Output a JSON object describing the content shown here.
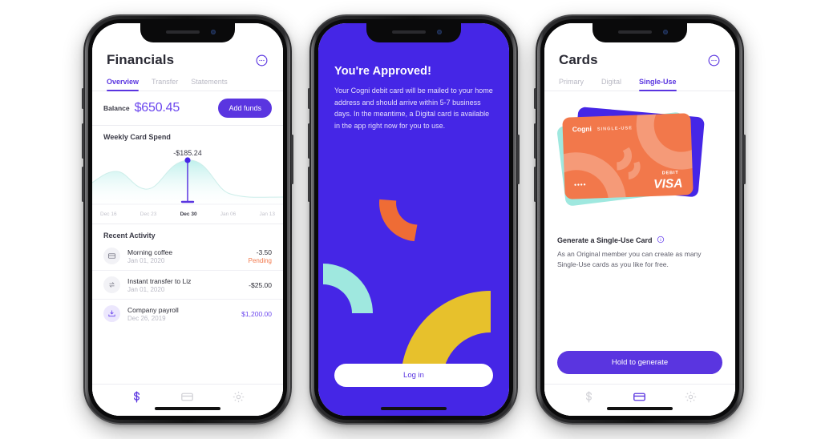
{
  "colors": {
    "brand_purple": "#5a35e0",
    "value_purple": "#6a45ee",
    "screen2_bg": "#4526e6",
    "accent_orange": "#f2784b",
    "accent_teal": "#9fe8df",
    "accent_yellow": "#e7c12c",
    "card_orange": "#f2784b",
    "muted_text": "#b9b9c4"
  },
  "phone1": {
    "header": {
      "title": "Financials",
      "support_icon": "support-chat-icon"
    },
    "tabs": [
      {
        "label": "Overview",
        "active": true
      },
      {
        "label": "Transfer",
        "active": false
      },
      {
        "label": "Statements",
        "active": false
      }
    ],
    "balance": {
      "label": "Balance",
      "value": "$650.45",
      "button": "Add funds"
    },
    "chart_section_title": "Weekly Card Spend",
    "activity": {
      "title": "Recent Activity",
      "items": [
        {
          "icon": "card-icon",
          "title": "Morning coffee",
          "date": "Jan 01, 2020",
          "amount": "-3.50",
          "status": "Pending",
          "positive": false,
          "highlight": false
        },
        {
          "icon": "transfer-arrows-icon",
          "title": "Instant transfer to Liz",
          "date": "Jan 01, 2020",
          "amount": "-$25.00",
          "status": "",
          "positive": false,
          "highlight": false
        },
        {
          "icon": "deposit-icon",
          "title": "Company payroll",
          "date": "Dec 26, 2019",
          "amount": "$1,200.00",
          "status": "",
          "positive": true,
          "highlight": true
        }
      ]
    },
    "tabbar": [
      {
        "icon": "dollar-icon",
        "active": true
      },
      {
        "icon": "card-icon",
        "active": false
      },
      {
        "icon": "gear-icon",
        "active": false
      }
    ]
  },
  "phone2": {
    "title": "You're Approved!",
    "body": "Your Cogni debit card will be mailed to your home address and should arrive within 5-7 business days. In the meantime, a Digital card is available in the app right now for you to use.",
    "login_button": "Log in"
  },
  "phone3": {
    "header": {
      "title": "Cards",
      "support_icon": "support-chat-icon"
    },
    "tabs": [
      {
        "label": "Primary",
        "active": false
      },
      {
        "label": "Digital",
        "active": false
      },
      {
        "label": "Single-Use",
        "active": true
      }
    ],
    "card": {
      "brand": "Cogni",
      "type": "SINGLE-USE",
      "dots": "••••",
      "debit_label": "DEBIT",
      "network": "VISA"
    },
    "generate": {
      "title": "Generate a Single-Use Card",
      "info_icon": "info-icon",
      "body": "As an Original member you can create as many Single-Use cards as you like for free.",
      "button": "Hold to generate"
    },
    "tabbar": [
      {
        "icon": "dollar-icon",
        "active": false
      },
      {
        "icon": "card-icon",
        "active": true
      },
      {
        "icon": "gear-icon",
        "active": false
      }
    ]
  },
  "chart_data": {
    "type": "area",
    "title": "Weekly Card Spend",
    "annotation": "-$185.24",
    "selected_category": "Dec 30",
    "categories": [
      "Dec 16",
      "Dec 23",
      "Dec 30",
      "Jan 06",
      "Jan 13"
    ],
    "tick_labels": [
      "Dec 16",
      "Dec 23",
      "Dec 30",
      "Jan 06",
      "Jan 13"
    ],
    "values": [
      62,
      38,
      100,
      46,
      12
    ],
    "x": [
      0,
      25,
      50,
      75,
      100
    ],
    "xlabel": "",
    "ylabel": "",
    "ylim": [
      0,
      110
    ],
    "grid": false,
    "legend": "none",
    "marker_point": {
      "x": "Dec 30",
      "y": 100,
      "label": "-$185.24"
    }
  }
}
